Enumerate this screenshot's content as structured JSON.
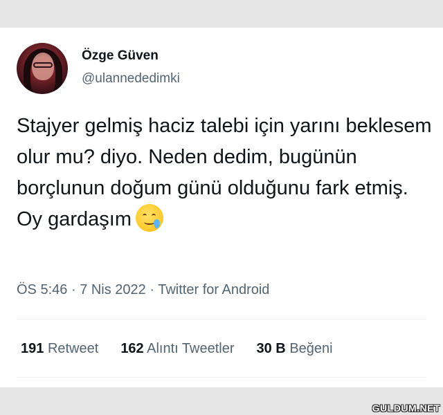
{
  "tweet": {
    "author": {
      "display_name": "Özge Güven",
      "handle": "@ulannededimki"
    },
    "text": "Stajyer gelmiş haciz talebi için yarını beklesem olur mu? diyo. Neden dedim, bugünün borçlunun doğum günü olduğunu fark etmiş. Oy gardaşım",
    "emoji": "smiling-face-with-tear-icon",
    "meta": {
      "time": "ÖS 5:46",
      "separator": "·",
      "date": "7 Nis 2022",
      "source": "Twitter for Android"
    },
    "stats": {
      "retweets_count": "191",
      "retweets_label": "Retweet",
      "quotes_count": "162",
      "quotes_label": "Alıntı Tweetler",
      "likes_count": "30 B",
      "likes_label": "Beğeni"
    }
  },
  "watermark": "GULDUM.NET",
  "colors": {
    "text_primary": "#0f1419",
    "text_secondary": "#536471",
    "background": "#e6e6e6",
    "card": "#ffffff"
  }
}
